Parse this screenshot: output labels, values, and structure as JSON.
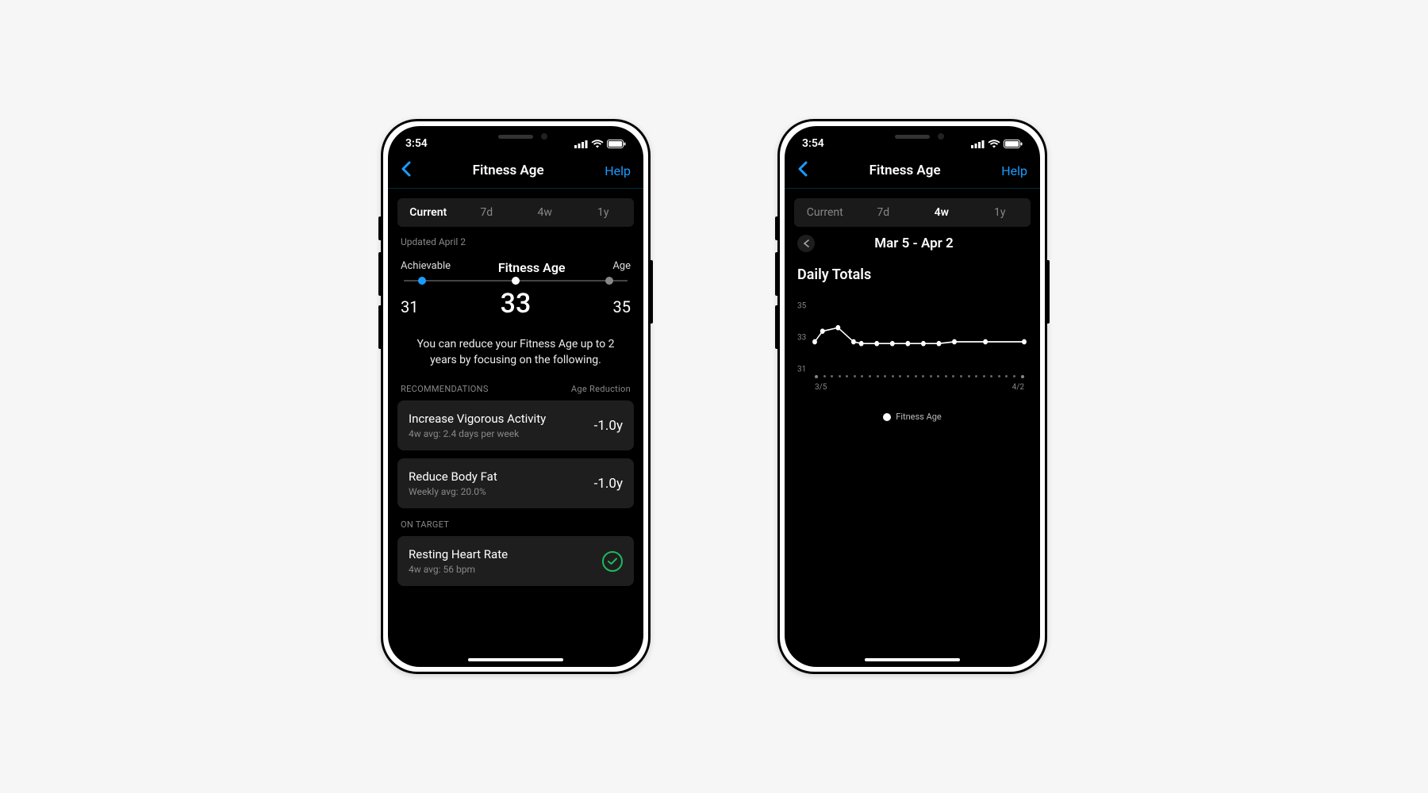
{
  "status": {
    "time": "3:54"
  },
  "nav": {
    "title": "Fitness Age",
    "help": "Help"
  },
  "tabs": [
    "Current",
    "7d",
    "4w",
    "1y"
  ],
  "left": {
    "active_tab": 0,
    "updated": "Updated April 2",
    "labels": {
      "achievable": "Achievable",
      "fitness": "Fitness Age",
      "age": "Age"
    },
    "values": {
      "achievable": "31",
      "fitness": "33",
      "age": "35"
    },
    "description": "You can reduce your Fitness Age up to 2 years by focusing on the following.",
    "rec_header": "RECOMMENDATIONS",
    "rec_header_right": "Age Reduction",
    "recs": [
      {
        "title": "Increase Vigorous Activity",
        "sub": "4w avg: 2.4 days per week",
        "delta": "-1.0y"
      },
      {
        "title": "Reduce Body Fat",
        "sub": "Weekly avg: 20.0%",
        "delta": "-1.0y"
      }
    ],
    "ontarget_header": "ON TARGET",
    "ontarget": {
      "title": "Resting Heart Rate",
      "sub": "4w avg: 56 bpm"
    }
  },
  "right": {
    "active_tab": 2,
    "range": "Mar 5 - Apr 2",
    "daily_title": "Daily Totals",
    "xstart": "3/5",
    "xend": "4/2",
    "legend": "Fitness Age"
  },
  "chart_data": {
    "type": "line",
    "title": "Daily Totals",
    "xlabel_start": "3/5",
    "xlabel_end": "4/2",
    "ylabel": "",
    "yticks": [
      31,
      33,
      35
    ],
    "ylim": [
      31,
      35
    ],
    "x": [
      0,
      1,
      3,
      5,
      6,
      8,
      10,
      12,
      14,
      16,
      18,
      22,
      27
    ],
    "values": [
      33.0,
      33.6,
      33.8,
      33.0,
      32.9,
      32.9,
      32.9,
      32.9,
      32.9,
      32.9,
      33.0,
      33.0,
      33.0
    ],
    "series_name": "Fitness Age"
  }
}
